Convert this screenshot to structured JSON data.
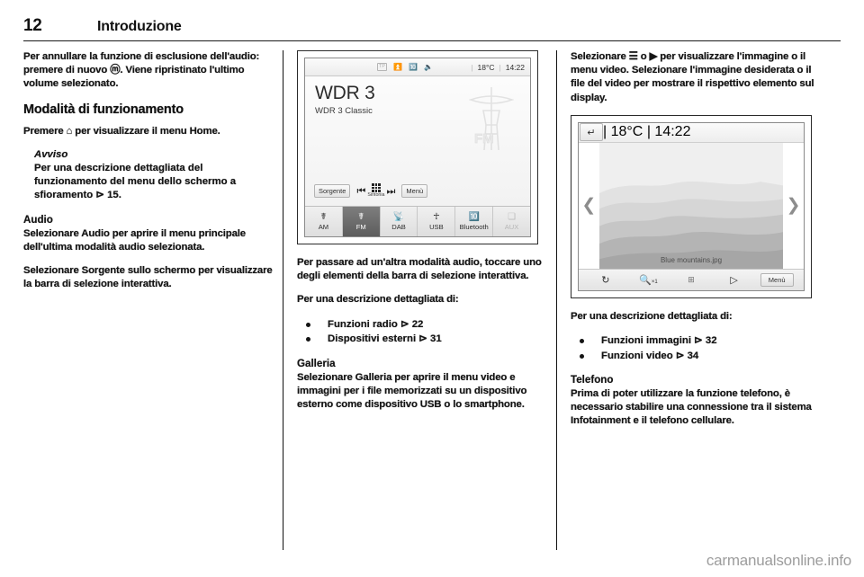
{
  "header": {
    "page_number": "12",
    "chapter_title": "Introduzione"
  },
  "left_column": {
    "para_1": "Per annullare la funzione di esclusione dell'audio: premere di nuovo ⓜ. Viene ripristinato l'ultimo volume selezionato.",
    "heading_modalita": "Modalità di funzionamento",
    "para_2": "Premere ⌂ per visualizzare il menu Home.",
    "note_title": "Avviso",
    "note_text": "Per una descrizione dettagliata del funzionamento del menu dello schermo a sfioramento ⊳ 15.",
    "heading_audio": "Audio",
    "para_3": "Selezionare Audio per aprire il menu principale dell'ultima modalità audio selezionata.",
    "para_4": "Selezionare Sorgente sullo schermo per visualizzare la barra di selezione interattiva."
  },
  "radio_screen": {
    "status": {
      "tp_label": "TP",
      "icons": [
        "tp-icon",
        "traffic-icon",
        "bluetooth-icon",
        "mute-icon"
      ],
      "temperature": "18°C",
      "time": "14:22"
    },
    "station_name": "WDR 3",
    "station_info": "WDR 3 Classic",
    "watermark_label": "FM",
    "controls": {
      "source_label": "Sorgente",
      "prev_icon": "skip-back-icon",
      "tune_label": "Sintonia",
      "next_icon": "skip-forward-icon",
      "menu_label": "Menù"
    },
    "tabs": [
      {
        "label": "AM",
        "icon": "antenna-icon",
        "state": "normal"
      },
      {
        "label": "FM",
        "icon": "antenna-icon",
        "state": "active"
      },
      {
        "label": "DAB",
        "icon": "satellite-icon",
        "state": "normal"
      },
      {
        "label": "USB",
        "icon": "usb-icon",
        "state": "normal"
      },
      {
        "label": "Bluetooth",
        "icon": "bluetooth-icon",
        "state": "normal"
      },
      {
        "label": "AUX",
        "icon": "aux-icon",
        "state": "disabled"
      }
    ]
  },
  "mid_column": {
    "para_1": "Per passare ad un'altra modalità audio, toccare uno degli elementi della barra di selezione interattiva.",
    "para_2": "Per una descrizione dettagliata di:",
    "bullets": [
      "Funzioni radio ⊳ 22",
      "Dispositivi esterni ⊳ 31"
    ],
    "heading_galleria": "Galleria",
    "para_3": "Selezionare Galleria per aprire il menu video e immagini per i file memorizzati su un dispositivo esterno come dispositivo USB o lo smartphone."
  },
  "right_column": {
    "para_1": "Selezionare ☰ o ▶ per visualizzare l'immagine o il menu video. Selezionare l'immagine desiderata o il file del video per mostrare il rispettivo elemento sul display.",
    "para_2": "Per una descrizione dettagliata di:",
    "bullets": [
      "Funzioni immagini ⊳ 32",
      "Funzioni video ⊳ 34"
    ],
    "heading_telefono": "Telefono",
    "para_3": "Prima di poter utilizzare la funzione telefono, è necessario stabilire una connessione tra il sistema Infotainment e il telefono cellulare."
  },
  "gallery_screen": {
    "back_icon": "back-arrow-icon",
    "temperature": "18°C",
    "time": "14:22",
    "prev_icon": "chevron-left-icon",
    "next_icon": "chevron-right-icon",
    "image_caption": "Blue mountains.jpg",
    "toolbar": {
      "rotate_icon": "rotate-icon",
      "zoom_label": "×1",
      "fit_icon": "fit-icon",
      "slideshow_icon": "slideshow-icon",
      "menu_label": "Menù"
    }
  },
  "watermark": "carmanualsonline.info"
}
